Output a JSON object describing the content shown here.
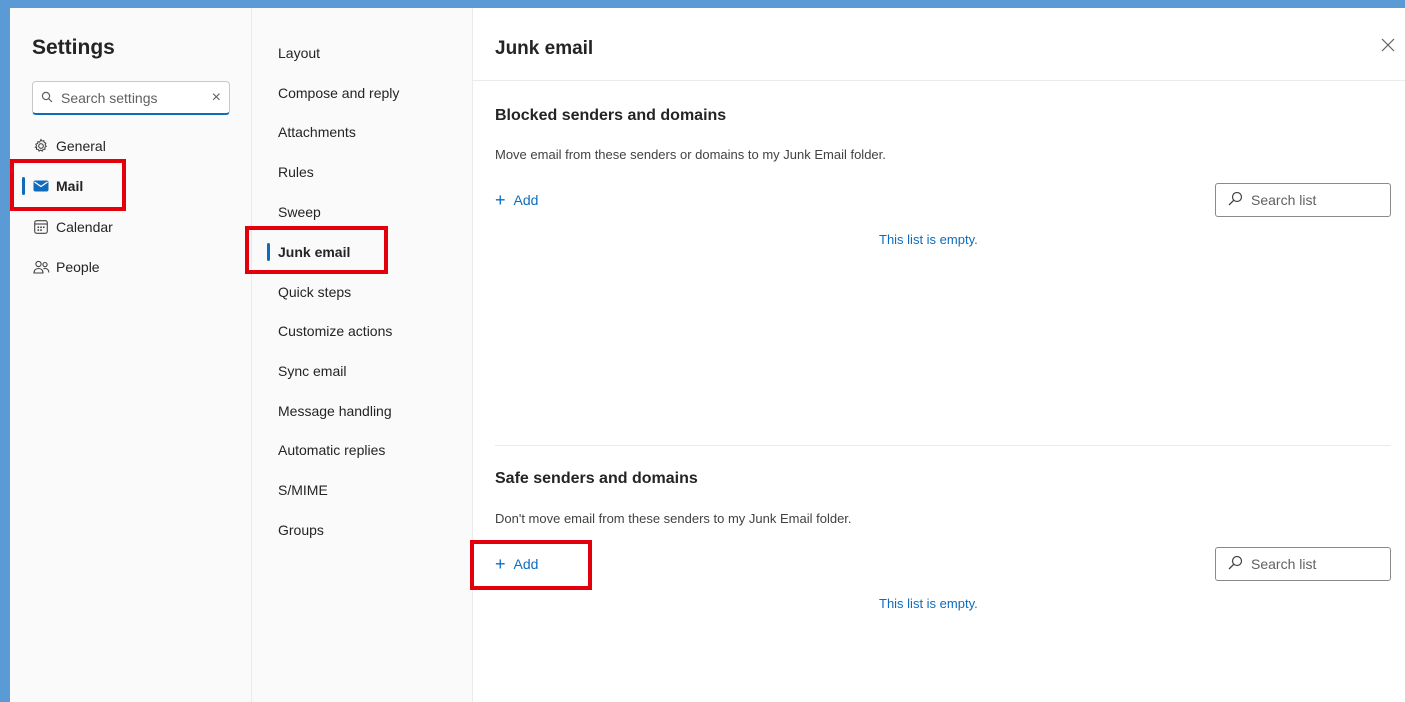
{
  "settings": {
    "title": "Settings",
    "search_placeholder": "Search settings",
    "nav": [
      {
        "label": "General",
        "icon": "gear-icon"
      },
      {
        "label": "Mail",
        "icon": "mail-icon",
        "active": true
      },
      {
        "label": "Calendar",
        "icon": "calendar-icon"
      },
      {
        "label": "People",
        "icon": "people-icon"
      }
    ]
  },
  "mail_submenu": [
    "Layout",
    "Compose and reply",
    "Attachments",
    "Rules",
    "Sweep",
    "Junk email",
    "Quick steps",
    "Customize actions",
    "Sync email",
    "Message handling",
    "Automatic replies",
    "S/MIME",
    "Groups"
  ],
  "content": {
    "title": "Junk email",
    "blocked": {
      "title": "Blocked senders and domains",
      "description": "Move email from these senders or domains to my Junk Email folder.",
      "add_label": "Add",
      "search_placeholder": "Search list",
      "empty_message": "This list is empty."
    },
    "safe": {
      "title": "Safe senders and domains",
      "description": "Don't move email from these senders to my Junk Email folder.",
      "add_label": "Add",
      "search_placeholder": "Search list",
      "empty_message": "This list is empty."
    }
  },
  "colors": {
    "accent": "#0f6cbd",
    "highlight": "#e3000b",
    "border_frame": "#5b9bd5"
  }
}
